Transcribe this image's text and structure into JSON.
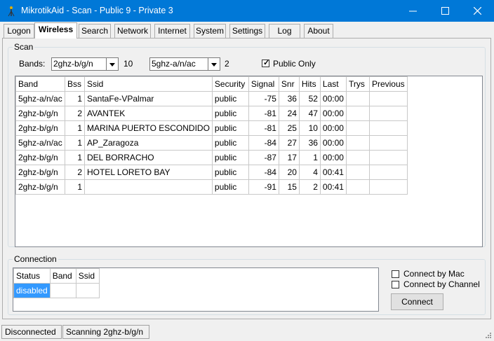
{
  "window": {
    "title": "MikrotikAid - Scan - Public 9 - Private 3"
  },
  "tabs": [
    {
      "label": "Logon"
    },
    {
      "label": "Wireless"
    },
    {
      "label": "Search"
    },
    {
      "label": "Network"
    },
    {
      "label": "Internet"
    },
    {
      "label": "System"
    },
    {
      "label": "Settings"
    },
    {
      "label": "Log"
    },
    {
      "label": "About"
    }
  ],
  "active_tab": "Wireless",
  "scan": {
    "group_label": "Scan",
    "bands_label": "Bands:",
    "band1": {
      "value": "2ghz-b/g/n",
      "count": "10"
    },
    "band2": {
      "value": "5ghz-a/n/ac",
      "count": "2"
    },
    "public_only": {
      "label": "Public Only",
      "checked": true
    },
    "columns": [
      "Band",
      "Bss",
      "Ssid",
      "Security",
      "Signal",
      "Snr",
      "Hits",
      "Last",
      "Trys",
      "Previous"
    ],
    "rows": [
      [
        "5ghz-a/n/ac",
        "1",
        "SantaFe-VPalmar",
        "public",
        "-75",
        "36",
        "52",
        "00:00",
        "",
        ""
      ],
      [
        "2ghz-b/g/n",
        "2",
        "AVANTEK",
        "public",
        "-81",
        "24",
        "47",
        "00:00",
        "",
        ""
      ],
      [
        "2ghz-b/g/n",
        "1",
        "MARINA PUERTO ESCONDIDO",
        "public",
        "-81",
        "25",
        "10",
        "00:00",
        "",
        ""
      ],
      [
        "5ghz-a/n/ac",
        "1",
        "AP_Zaragoza",
        "public",
        "-84",
        "27",
        "36",
        "00:00",
        "",
        ""
      ],
      [
        "2ghz-b/g/n",
        "1",
        "DEL BORRACHO",
        "public",
        "-87",
        "17",
        "1",
        "00:00",
        "",
        ""
      ],
      [
        "2ghz-b/g/n",
        "2",
        "HOTEL LORETO BAY",
        "public",
        "-84",
        "20",
        "4",
        "00:41",
        "",
        ""
      ],
      [
        "2ghz-b/g/n",
        "1",
        "",
        "public",
        "-91",
        "15",
        "2",
        "00:41",
        "",
        ""
      ]
    ]
  },
  "connection": {
    "group_label": "Connection",
    "columns": [
      "Status",
      "Band",
      "Ssid"
    ],
    "row": [
      "disabled",
      "",
      ""
    ],
    "connect_by_mac": {
      "label": "Connect by Mac",
      "checked": false
    },
    "connect_by_channel": {
      "label": "Connect by Channel",
      "checked": false
    },
    "connect_button": "Connect"
  },
  "status": {
    "left": "Disconnected",
    "right": "Scanning 2ghz-b/g/n"
  },
  "colors": {
    "titlebar": "#0078d7",
    "selection": "#3399ff"
  }
}
